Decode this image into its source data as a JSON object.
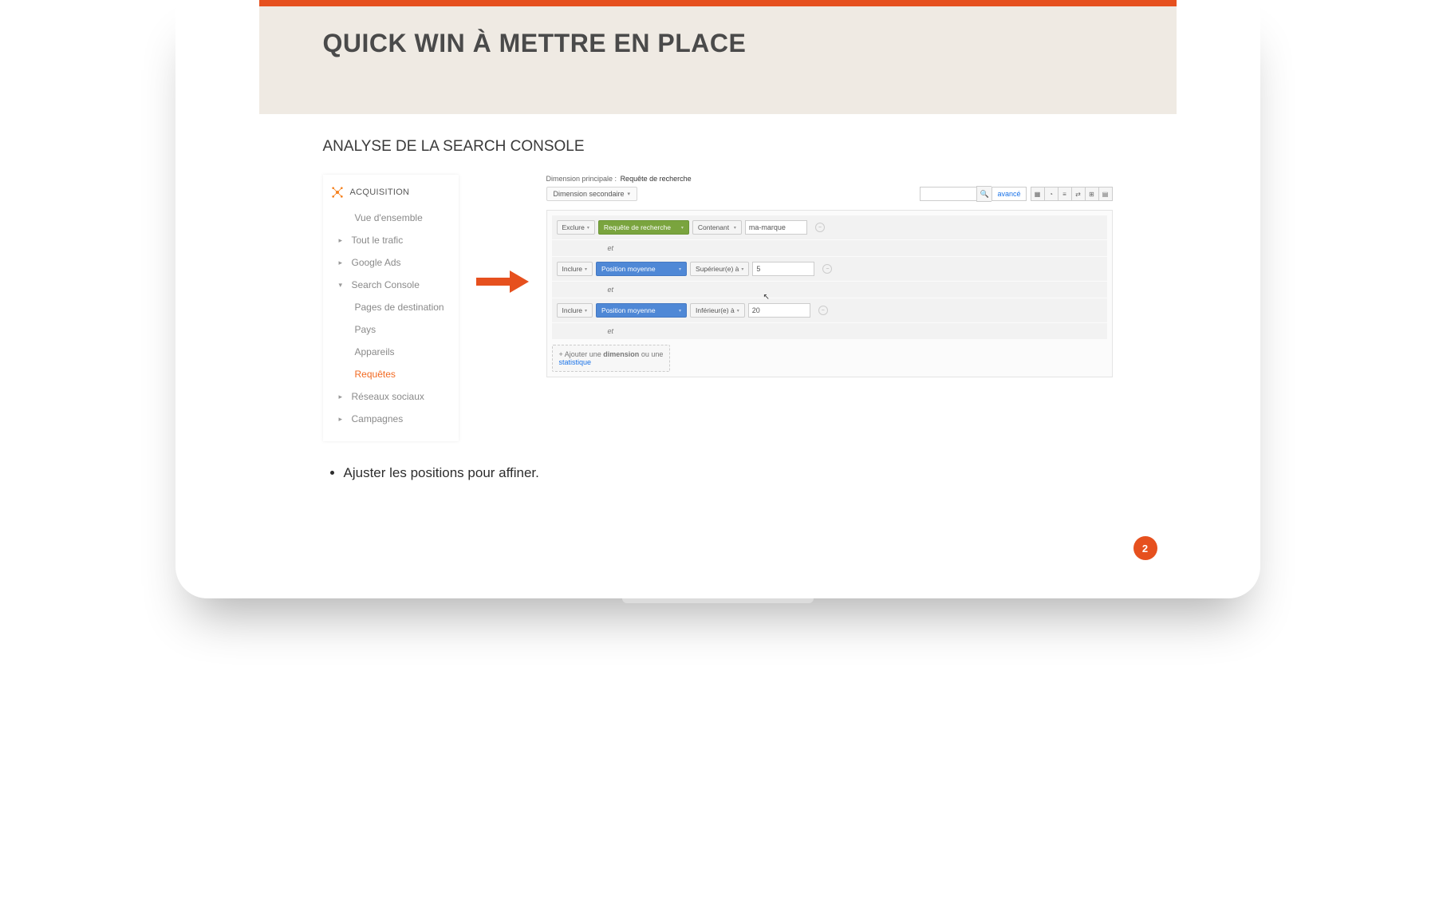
{
  "slide": {
    "title": "QUICK WIN À METTRE EN PLACE",
    "subheading": "ANALYSE DE LA SEARCH CONSOLE",
    "page_number": "2",
    "bullet": "Ajuster les positions pour affiner."
  },
  "ga_nav": {
    "section": "ACQUISITION",
    "items": [
      {
        "label": "Vue d'ensemble",
        "caret": false,
        "sub": true
      },
      {
        "label": "Tout le trafic",
        "caret": true
      },
      {
        "label": "Google Ads",
        "caret": true
      },
      {
        "label": "Search Console",
        "caret": true,
        "expanded": true
      },
      {
        "label": "Pages de destination",
        "caret": false,
        "sub": true
      },
      {
        "label": "Pays",
        "caret": false,
        "sub": true
      },
      {
        "label": "Appareils",
        "caret": false,
        "sub": true
      },
      {
        "label": "Requêtes",
        "caret": false,
        "sub": true,
        "active": true
      },
      {
        "label": "Réseaux sociaux",
        "caret": true
      },
      {
        "label": "Campagnes",
        "caret": true
      }
    ]
  },
  "filter": {
    "primary_dim_label": "Dimension principale :",
    "primary_dim_value": "Requête de recherche",
    "secondary_dim": "Dimension secondaire",
    "advanced": "avancé",
    "and_label": "et",
    "rows": [
      {
        "mode": "Exclure",
        "dim": "Requête de recherche",
        "dim_color": "green",
        "op": "Contenant",
        "value": "ma-marque"
      },
      {
        "mode": "Inclure",
        "dim": "Position moyenne",
        "dim_color": "blue",
        "op": "Supérieur(e) à",
        "value": "5"
      },
      {
        "mode": "Inclure",
        "dim": "Position moyenne",
        "dim_color": "blue",
        "op": "Inférieur(e) à",
        "value": "20"
      }
    ],
    "add_dim_prefix": "+ Ajouter une ",
    "add_dim_bold": "dimension",
    "add_dim_mid": " ou une ",
    "add_dim_link": "statistique"
  }
}
